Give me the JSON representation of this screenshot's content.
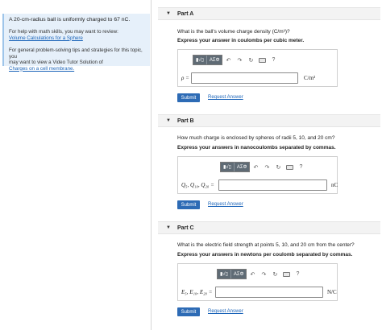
{
  "problem": {
    "statement": "A 20-cm-radius ball is uniformly charged to 67 nC.",
    "help_math": "For help with math skills, you may want to review:",
    "help_math_link": "Volume Calculations for a Sphere",
    "help_tips_1": "For general problem-solving tips and strategies for this topic, you",
    "help_tips_2": "may want to view a Video Tutor Solution of",
    "help_tips_link": "Charges on a cell membrane."
  },
  "toolbar": {
    "templates": "▮√▯",
    "symbols": "ΑΣΦ",
    "help": "?"
  },
  "parts": [
    {
      "title": "Part A",
      "question": "What is the ball's volume charge density (C/m³)?",
      "instruction": "Express your answer in coulombs per cubic meter.",
      "variable": "ρ =",
      "unit": "C/m³",
      "submit": "Submit",
      "request": "Request Answer"
    },
    {
      "title": "Part B",
      "question": "How much charge is enclosed by spheres of radii 5, 10, and 20 cm?",
      "instruction": "Express your answers in nanocoulombs separated by commas.",
      "variable": "Q₅, Q₁₀, Q₂₀ =",
      "unit": "nC",
      "submit": "Submit",
      "request": "Request Answer"
    },
    {
      "title": "Part C",
      "question": "What is the electric field strength at points 5, 10, and 20 cm from the center?",
      "instruction": "Express your answers in newtons per coulomb separated by commas.",
      "variable": "E₅, E₁₀, E₂₀ =",
      "unit": "N/C",
      "submit": "Submit",
      "request": "Request Answer"
    }
  ],
  "icons": {
    "undo": "↶",
    "redo": "↷",
    "reset": "↻",
    "keyboard": "keyboard-icon",
    "caret": "▼"
  }
}
